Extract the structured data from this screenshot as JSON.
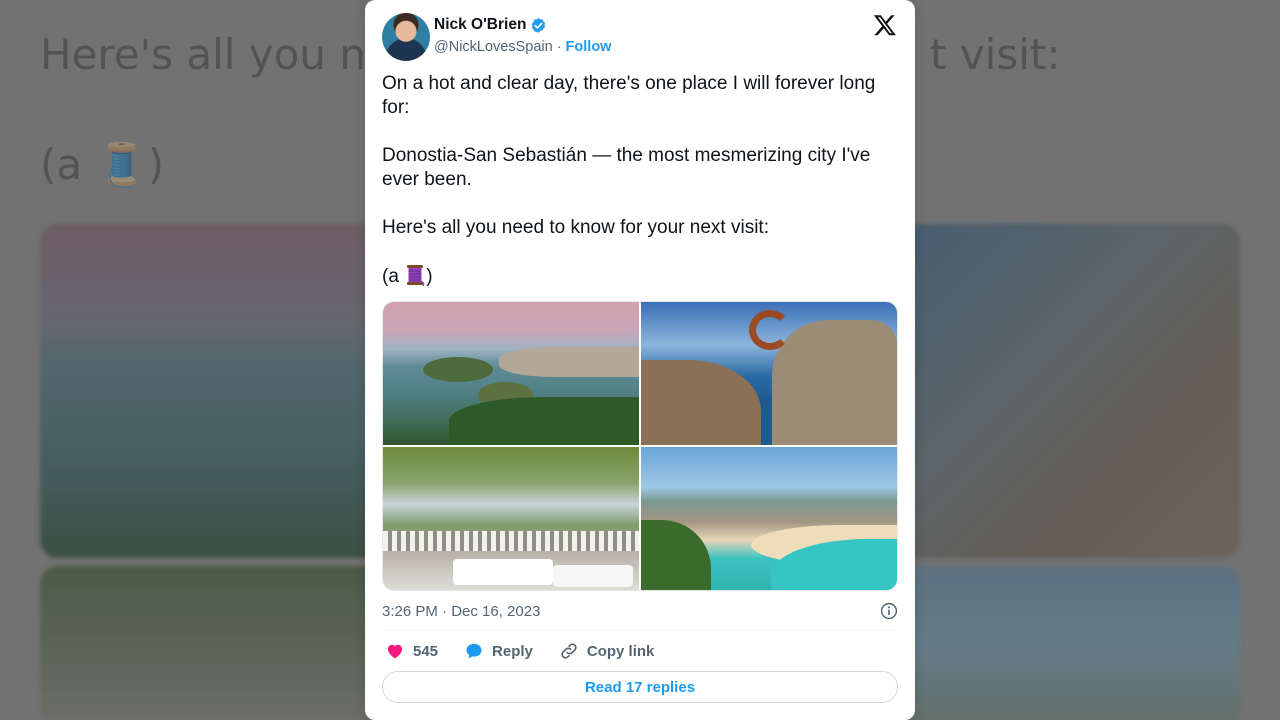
{
  "background": {
    "title_left": "Here's all you n",
    "title_right": "t visit:",
    "spool_line": "(a 🧵)"
  },
  "tweet": {
    "author_name": "Nick O'Brien",
    "handle": "@NickLovesSpain",
    "separator": "·",
    "follow_label": "Follow",
    "text": {
      "p1": "On a hot and clear day, there's one place I will forever long for:",
      "p2": "Donostia-San Sebastián — the most mesmerizing city I've ever been.",
      "p3": "Here's all you need to know for your next visit:",
      "p4_prefix": "(a ",
      "p4_suffix": ")"
    },
    "timestamp": "3:26 PM · Dec 16, 2023",
    "likes_count": "545",
    "reply_label": "Reply",
    "copy_link_label": "Copy link",
    "read_replies_label": "Read 17 replies"
  },
  "icons": {
    "verified": "verified-badge-icon",
    "x_logo": "x-logo-icon",
    "info": "info-icon",
    "heart": "heart-icon",
    "reply": "reply-bubble-icon",
    "link": "link-icon",
    "thread": "spool-of-thread-emoji"
  },
  "colors": {
    "accent": "#1d9bf0",
    "like": "#f91880",
    "text": "#0f1419",
    "muted": "#536471"
  }
}
